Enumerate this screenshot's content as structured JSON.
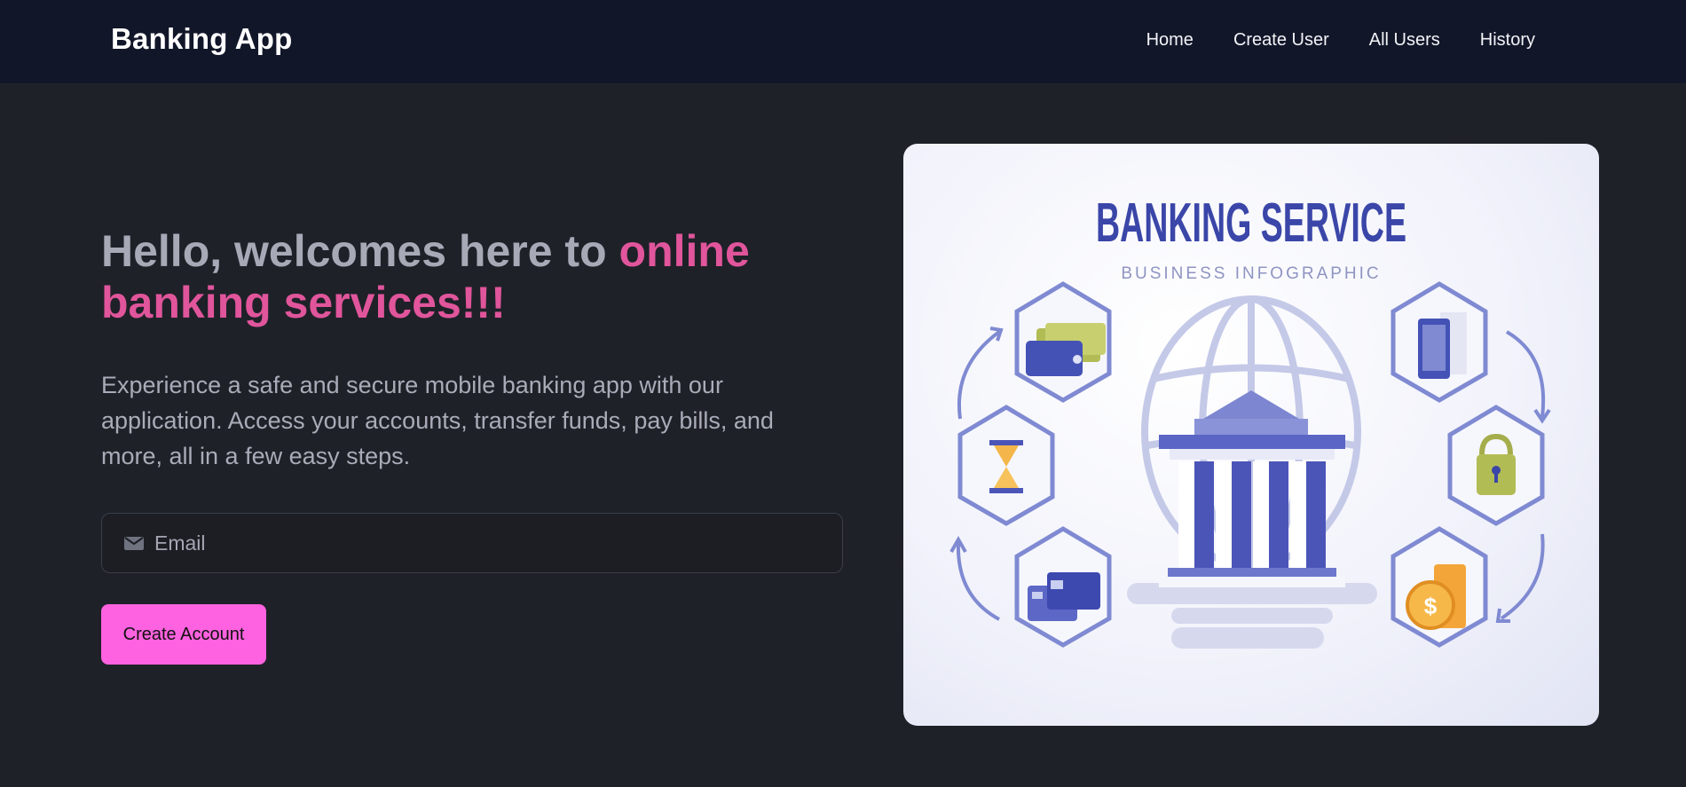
{
  "header": {
    "brand": "Banking App",
    "nav": [
      {
        "label": "Home"
      },
      {
        "label": "Create User"
      },
      {
        "label": "All Users"
      },
      {
        "label": "History"
      }
    ]
  },
  "hero": {
    "headline_plain": "Hello, welcomes here to ",
    "headline_accent": "online banking services!!!",
    "lead": "Experience a safe and secure mobile banking app with our application. Access your accounts, transfer funds, pay bills, and more, all in a few easy steps."
  },
  "form": {
    "email_placeholder": "Email",
    "email_icon": "envelope-icon",
    "submit_label": "Create Account"
  },
  "illustration": {
    "title": "BANKING SERVICE",
    "subtitle": "BUSINESS INFOGRAPHIC",
    "icons": [
      "wallet-icon",
      "hourglass-icon",
      "credit-card-icon",
      "smartphone-icon",
      "padlock-icon",
      "coins-icon",
      "bank-building-icon",
      "globe-icon"
    ]
  },
  "colors": {
    "background": "#1f2128",
    "navbar": "#121629",
    "accent_text": "#e0559b",
    "button": "#ff62e0",
    "illustration_primary": "#3a46a8"
  }
}
